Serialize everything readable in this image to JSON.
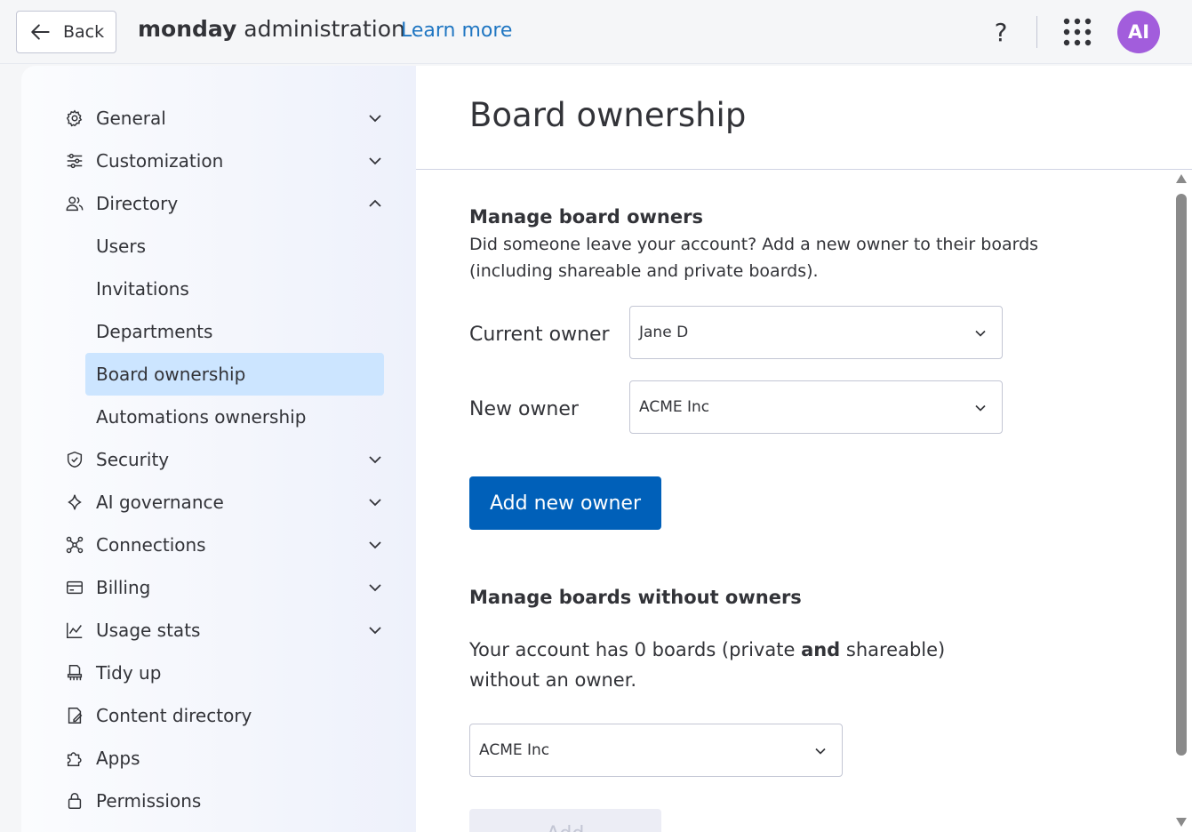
{
  "topbar": {
    "back_label": "Back",
    "brand_bold": "monday",
    "brand_rest": " administration",
    "learn_more": "Learn more",
    "help": "?",
    "avatar_initials": "AI",
    "avatar_color": "#a25ddc"
  },
  "sidebar": {
    "items": [
      {
        "label": "General",
        "icon": "gear-icon",
        "expanded": false
      },
      {
        "label": "Customization",
        "icon": "sliders-icon",
        "expanded": false
      },
      {
        "label": "Directory",
        "icon": "users-icon",
        "expanded": true
      },
      {
        "label": "Security",
        "icon": "shield-icon",
        "expanded": false
      },
      {
        "label": "AI governance",
        "icon": "sparkle-icon",
        "expanded": false
      },
      {
        "label": "Connections",
        "icon": "connections-icon",
        "expanded": false
      },
      {
        "label": "Billing",
        "icon": "billing-icon",
        "expanded": false
      },
      {
        "label": "Usage stats",
        "icon": "chart-icon",
        "expanded": false
      },
      {
        "label": "Tidy up",
        "icon": "broom-icon"
      },
      {
        "label": "Content directory",
        "icon": "document-icon"
      },
      {
        "label": "Apps",
        "icon": "puzzle-icon"
      },
      {
        "label": "Permissions",
        "icon": "lock-icon"
      }
    ],
    "directory_sub": [
      {
        "label": "Users"
      },
      {
        "label": "Invitations"
      },
      {
        "label": "Departments"
      },
      {
        "label": "Board ownership",
        "active": true
      },
      {
        "label": "Automations ownership"
      }
    ]
  },
  "main": {
    "title": "Board ownership",
    "manage_owners": {
      "title": "Manage board owners",
      "description": "Did someone leave your account? Add a new owner to their boards (including shareable and private boards).",
      "current_owner_label": "Current owner",
      "current_owner_value": "Jane D",
      "new_owner_label": "New owner",
      "new_owner_value": "ACME Inc",
      "add_button": "Add new owner"
    },
    "without_owners": {
      "title": "Manage boards without owners",
      "desc_pre": "Your account has 0 boards (private ",
      "desc_bold": "and",
      "desc_post": " shareable) without an owner.",
      "owner_value": "ACME Inc",
      "add_button": "Add"
    }
  },
  "colors": {
    "primary": "#0060b9",
    "active_nav": "#cce5ff",
    "link": "#1f76c2"
  }
}
